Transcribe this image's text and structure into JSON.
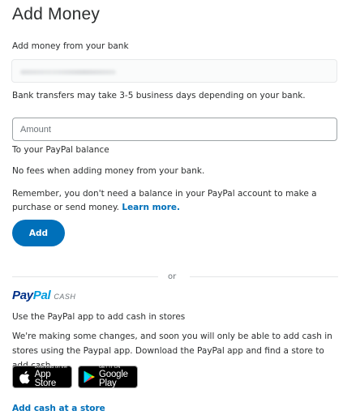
{
  "page": {
    "title": "Add Money"
  },
  "bank": {
    "label": "Add money from your bank",
    "transfer_note": "Bank transfers may take 3-5 business days depending on your bank."
  },
  "amount": {
    "placeholder": "Amount",
    "value": "",
    "destination": "To your PayPal balance"
  },
  "info": {
    "no_fees": "No fees when adding money from your bank.",
    "reminder": "Remember, you don't need a balance in your PayPal account to make a purchase or send money.",
    "learn_more": "Learn more."
  },
  "actions": {
    "add_label": "Add"
  },
  "separator": {
    "or_label": "or"
  },
  "paypal_cash": {
    "logo_pay": "Pay",
    "logo_pal": "Pal",
    "logo_cash": "CASH",
    "use_app": "Use the PayPal app to add cash in stores",
    "notice": "We're making some changes, and soon you will only be able to add cash in stores using the Paypal app. Download the PayPal app and find a store to add cash.",
    "app_store_small": "Download on the",
    "app_store_big": "App Store",
    "google_play_small": "GET IT ON",
    "google_play_big": "Google Play",
    "add_cash_link": "Add cash at a store"
  },
  "colors": {
    "primary_blue": "#0070ba",
    "paypal_dark_blue": "#003087",
    "paypal_light_blue": "#009cde",
    "text": "#2c2e2f"
  }
}
